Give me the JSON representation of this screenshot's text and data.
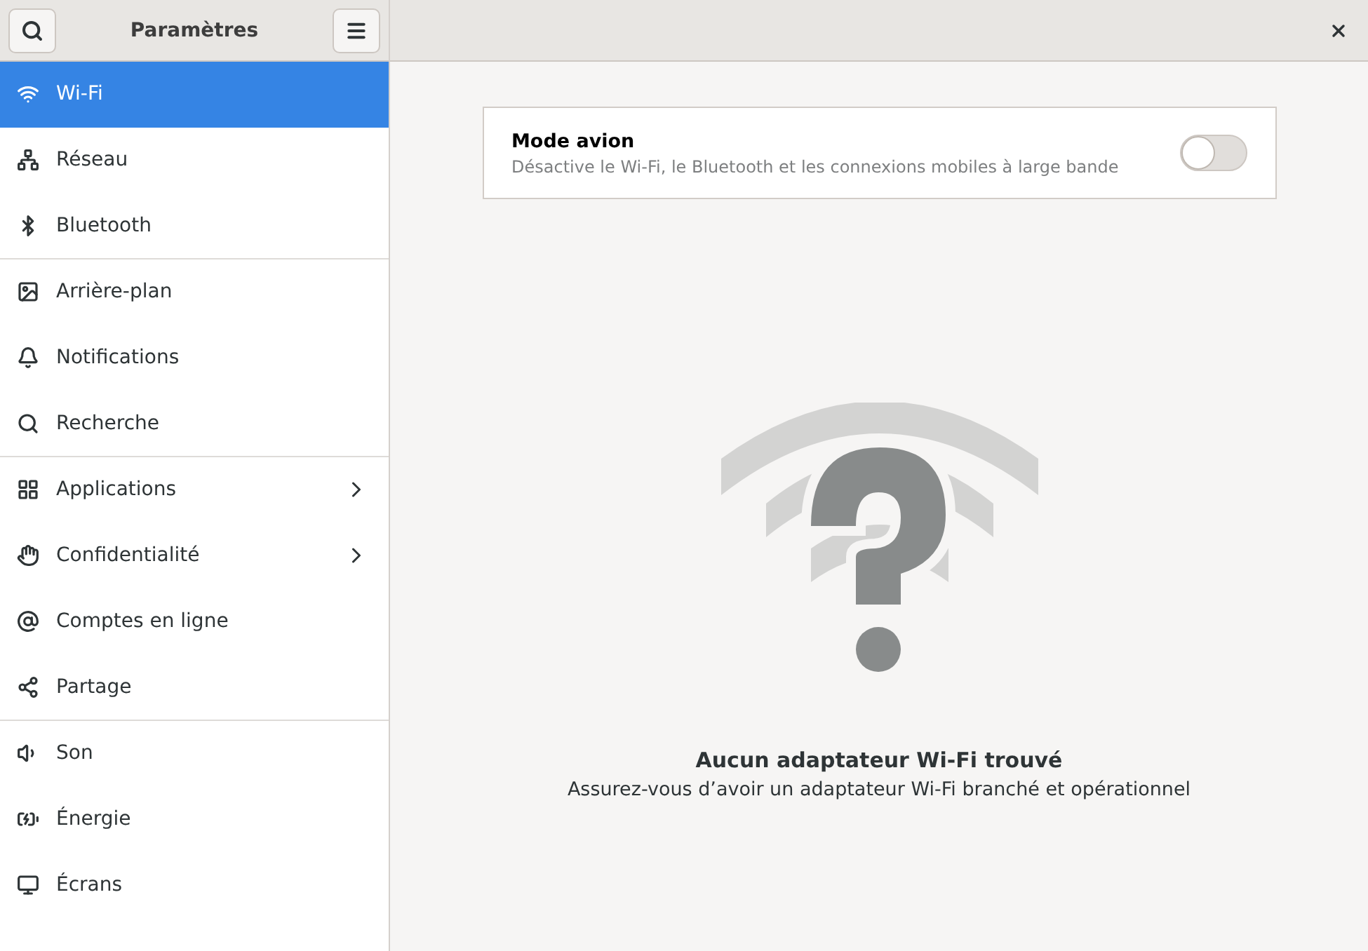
{
  "header": {
    "title": "Paramètres"
  },
  "sidebar": {
    "items": [
      {
        "label": "Wi-Fi",
        "selected": true,
        "submenu": false,
        "separator_after": false
      },
      {
        "label": "Réseau",
        "selected": false,
        "submenu": false,
        "separator_after": false
      },
      {
        "label": "Bluetooth",
        "selected": false,
        "submenu": false,
        "separator_after": true
      },
      {
        "label": "Arrière-plan",
        "selected": false,
        "submenu": false,
        "separator_after": false
      },
      {
        "label": "Notifications",
        "selected": false,
        "submenu": false,
        "separator_after": false
      },
      {
        "label": "Recherche",
        "selected": false,
        "submenu": false,
        "separator_after": true
      },
      {
        "label": "Applications",
        "selected": false,
        "submenu": true,
        "separator_after": false
      },
      {
        "label": "Confidentialité",
        "selected": false,
        "submenu": true,
        "separator_after": false
      },
      {
        "label": "Comptes en ligne",
        "selected": false,
        "submenu": false,
        "separator_after": false
      },
      {
        "label": "Partage",
        "selected": false,
        "submenu": false,
        "separator_after": true
      },
      {
        "label": "Son",
        "selected": false,
        "submenu": false,
        "separator_after": false
      },
      {
        "label": "Énergie",
        "selected": false,
        "submenu": false,
        "separator_after": false
      },
      {
        "label": "Écrans",
        "selected": false,
        "submenu": false,
        "separator_after": false
      }
    ]
  },
  "airplane": {
    "title": "Mode avion",
    "description": "Désactive le Wi-Fi, le Bluetooth et les connexions mobiles à large bande",
    "on": false
  },
  "empty_state": {
    "title": "Aucun adaptateur Wi-Fi trouvé",
    "subtitle": "Assurez-vous d’avoir un adaptateur Wi-Fi branché et opérationnel"
  }
}
